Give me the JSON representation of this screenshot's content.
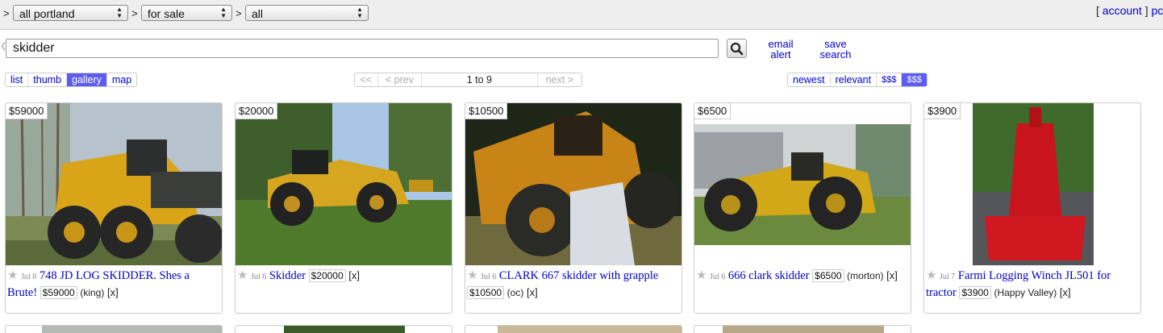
{
  "breadcrumbs": {
    "lead": ">",
    "sep": ">",
    "area": "all portland",
    "category": "for sale",
    "subcategory": "all"
  },
  "account": {
    "open": "[",
    "label": "account",
    "close": "]",
    "extra": "pc"
  },
  "search": {
    "value": "skidder",
    "email_alert": [
      "email",
      "alert"
    ],
    "save_search": [
      "save",
      "search"
    ]
  },
  "views": [
    "list",
    "thumb",
    "gallery",
    "map"
  ],
  "active_view": "gallery",
  "pager": {
    "first": "<<",
    "prev": "< prev",
    "range": "1 to 9",
    "next": "next >"
  },
  "sort": [
    "newest",
    "relevant",
    "$$$",
    "$$$"
  ],
  "active_sort": 3,
  "listings": [
    {
      "price_tag": "$59000",
      "date": "Jul 8",
      "title": "748 JD LOG SKIDDER. Shes a Brute!",
      "price": "$59000",
      "location": "(king)",
      "hide": "[x]"
    },
    {
      "price_tag": "$20000",
      "date": "Jul 6",
      "title": "Skidder",
      "price": "$20000",
      "location": "",
      "hide": "[x]"
    },
    {
      "price_tag": "$10500",
      "date": "Jul 6",
      "title": "CLARK 667 skidder with grapple",
      "price": "$10500",
      "location": "(oc)",
      "hide": "[x]"
    },
    {
      "price_tag": "$6500",
      "date": "Jul 6",
      "title": "666 clark skidder",
      "price": "$6500",
      "location": "(morton)",
      "hide": "[x]"
    },
    {
      "price_tag": "$3900",
      "date": "Jul 7",
      "title": "Farmi Logging Winch JL501 for tractor",
      "price": "$3900",
      "location": "(Happy Valley)",
      "hide": "[x]"
    }
  ],
  "colors": {
    "link": "#0000cc",
    "active": "#5c5cf0",
    "topbar": "#eeeeee",
    "skidder_yellow": "#d9a417",
    "winch_red": "#c8141c"
  }
}
